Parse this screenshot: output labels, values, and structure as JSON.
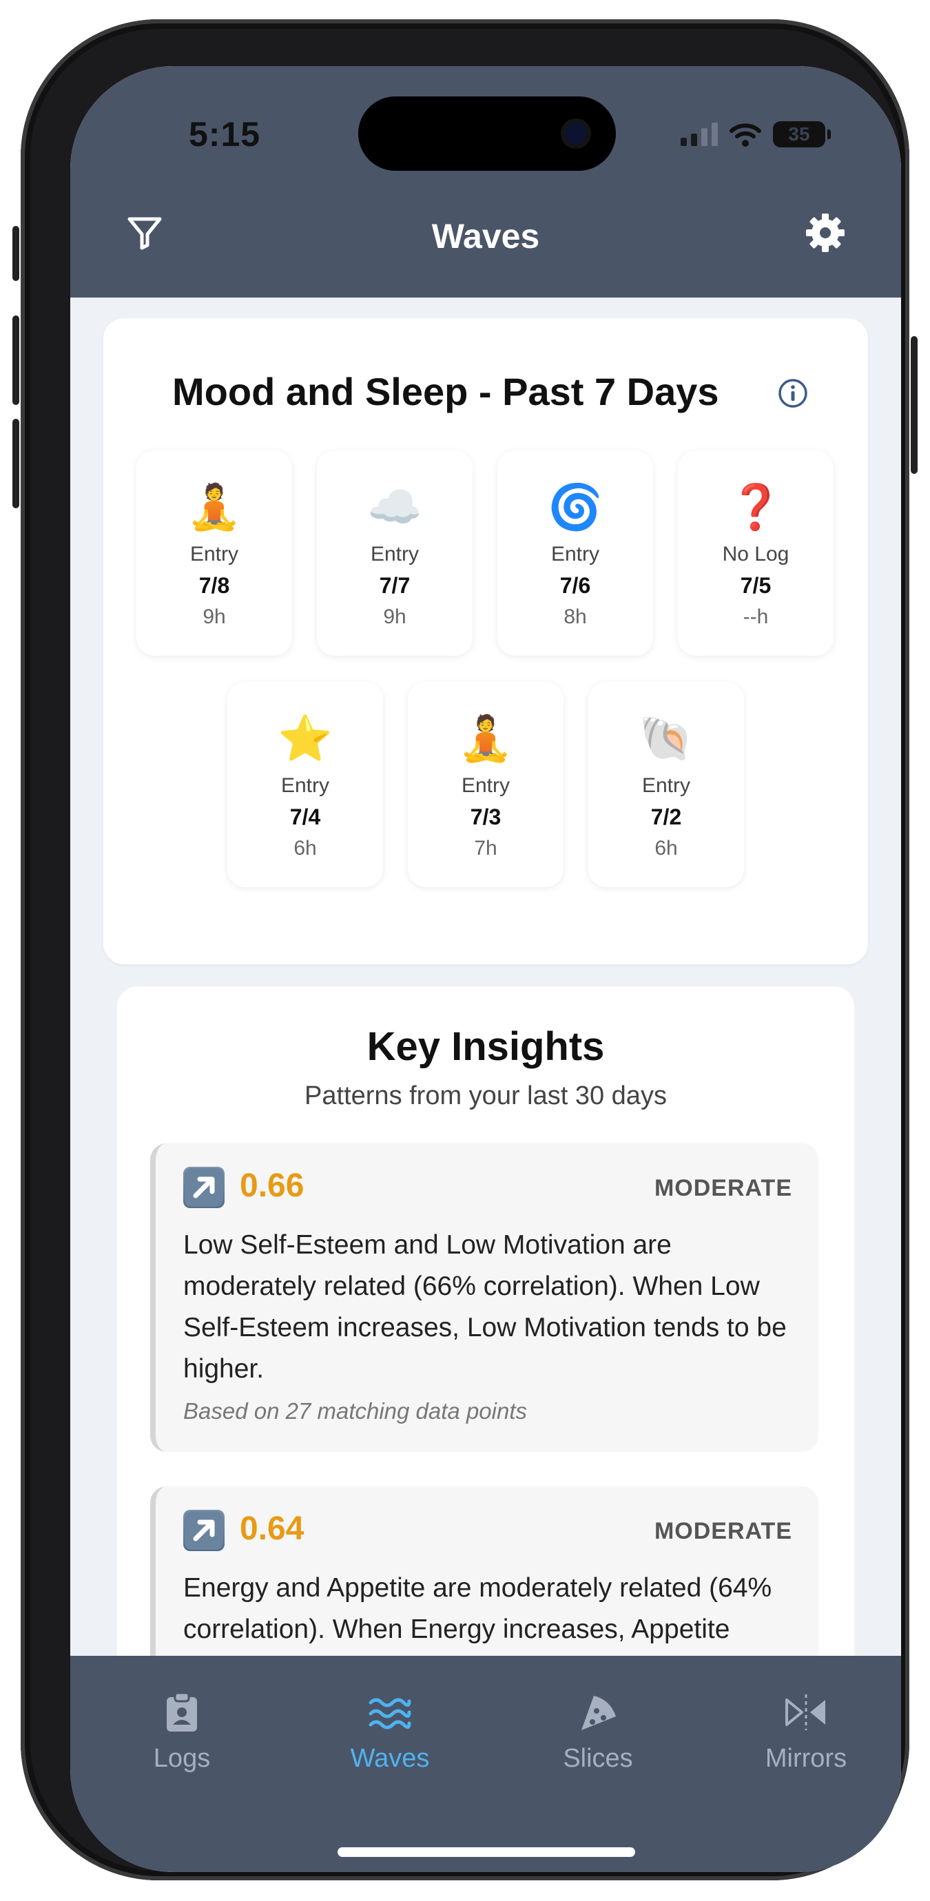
{
  "status": {
    "time": "5:15",
    "battery": "35"
  },
  "header": {
    "title": "Waves"
  },
  "mood_sleep": {
    "title": "Mood and Sleep - Past 7 Days",
    "days": [
      {
        "emoji": "🧘",
        "label": "Entry",
        "date": "7/8",
        "hours": "9h"
      },
      {
        "emoji": "☁️",
        "label": "Entry",
        "date": "7/7",
        "hours": "9h"
      },
      {
        "emoji": "🌀",
        "label": "Entry",
        "date": "7/6",
        "hours": "8h"
      },
      {
        "emoji": "❓",
        "label": "No Log",
        "date": "7/5",
        "hours": "--h"
      },
      {
        "emoji": "⭐",
        "label": "Entry",
        "date": "7/4",
        "hours": "6h"
      },
      {
        "emoji": "🧘",
        "label": "Entry",
        "date": "7/3",
        "hours": "7h"
      },
      {
        "emoji": "🐚",
        "label": "Entry",
        "date": "7/2",
        "hours": "6h"
      }
    ]
  },
  "insights": {
    "title": "Key Insights",
    "subtitle": "Patterns from your last 30 days",
    "items": [
      {
        "score": "0.66",
        "strength": "MODERATE",
        "text": "Low Self-Esteem and Low Motivation are moderately related (66% correlation). When Low Self-Esteem increases, Low Motivation tends to be higher.",
        "basis": "Based on 27 matching data points"
      },
      {
        "score": "0.64",
        "strength": "MODERATE",
        "text": "Energy and Appetite are moderately related (64% correlation). When Energy increases, Appetite tends to be higher.",
        "basis": ""
      }
    ]
  },
  "tabs": [
    {
      "label": "Logs",
      "icon": "clipboard-user-icon"
    },
    {
      "label": "Waves",
      "icon": "waves-icon"
    },
    {
      "label": "Slices",
      "icon": "pizza-slice-icon"
    },
    {
      "label": "Mirrors",
      "icon": "mirror-icon"
    }
  ],
  "colors": {
    "header": "#4a5568",
    "accent": "#4fb3f0",
    "score": "#e89a14"
  }
}
